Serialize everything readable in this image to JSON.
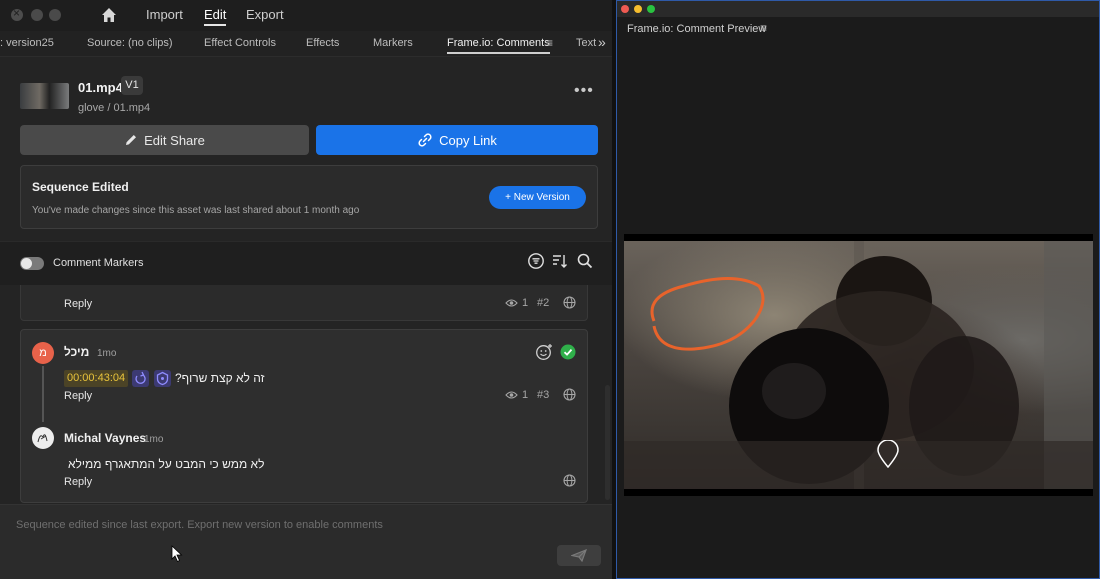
{
  "menu": {
    "import": "Import",
    "edit": "Edit",
    "export": "Export"
  },
  "tabs": [
    ": version25",
    "Source: (no clips)",
    "Effect Controls",
    "Effects",
    "Markers",
    "Frame.io: Comments",
    "Text"
  ],
  "asset": {
    "name": "01.mp4",
    "version": "V1",
    "path": "glove / 01.mp4",
    "more": "•••"
  },
  "buttons": {
    "edit_share": "Edit Share",
    "copy_link": "Copy Link"
  },
  "sequence": {
    "title": "Sequence Edited",
    "subtitle": "You've made changes since this asset was last shared about 1 month ago",
    "new_version": "+ New Version"
  },
  "markers": {
    "label": "Comment Markers"
  },
  "prev_comment": {
    "reply": "Reply",
    "views": "1",
    "number": "#2"
  },
  "comment": {
    "avatar": "מ",
    "author": "מיכל",
    "time": "1mo",
    "timecode": "00:00:43:04",
    "text": "זה לא קצת שרוף?",
    "reply": "Reply",
    "views": "1",
    "number": "#3"
  },
  "reply_comment": {
    "author": "Michal Vaynes",
    "time": "1mo",
    "text": "לא ממש כי המבט על המתאגרף ממילא",
    "reply": "Reply"
  },
  "composer": {
    "placeholder": "Sequence edited since last export. Export new version to enable comments"
  },
  "preview": {
    "title": "Frame.io: Comment Preview"
  },
  "colors": {
    "accent": "#1a73e8",
    "resolved": "#2fb04a",
    "annotation": "#e8632b",
    "timecode": "#e8c33b"
  }
}
